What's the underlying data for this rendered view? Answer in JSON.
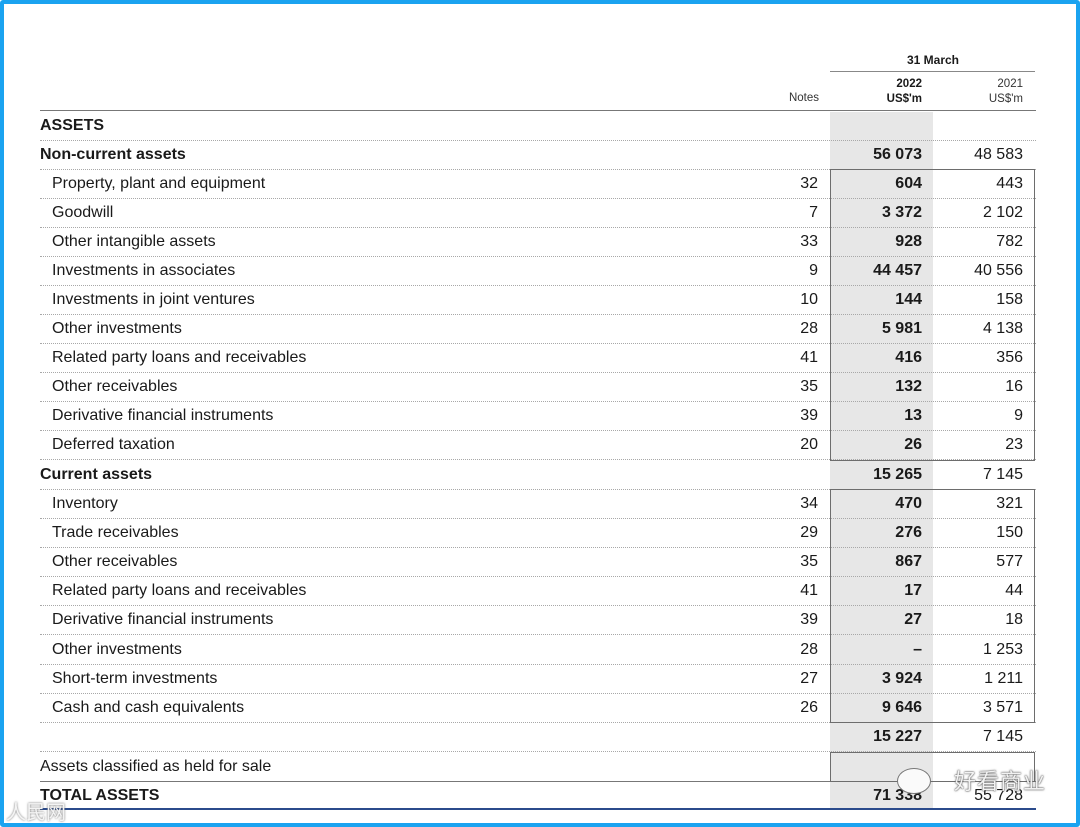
{
  "header": {
    "period": "31 March",
    "year_current": "2022",
    "unit_current": "US$'m",
    "year_prior": "2021",
    "unit_prior": "US$'m",
    "notes_label": "Notes"
  },
  "rows": [
    {
      "label": "ASSETS",
      "note": "",
      "v2022": "",
      "v2021": ""
    },
    {
      "label": "Non-current assets",
      "note": "",
      "v2022": "56 073",
      "v2021": "48 583"
    },
    {
      "label": "Property, plant and equipment",
      "note": "32",
      "v2022": "604",
      "v2021": "443"
    },
    {
      "label": "Goodwill",
      "note": "7",
      "v2022": "3 372",
      "v2021": "2 102"
    },
    {
      "label": "Other intangible assets",
      "note": "33",
      "v2022": "928",
      "v2021": "782"
    },
    {
      "label": "Investments in associates",
      "note": "9",
      "v2022": "44 457",
      "v2021": "40 556"
    },
    {
      "label": "Investments in joint ventures",
      "note": "10",
      "v2022": "144",
      "v2021": "158"
    },
    {
      "label": "Other investments",
      "note": "28",
      "v2022": "5 981",
      "v2021": "4 138"
    },
    {
      "label": "Related party loans and receivables",
      "note": "41",
      "v2022": "416",
      "v2021": "356"
    },
    {
      "label": "Other receivables",
      "note": "35",
      "v2022": "132",
      "v2021": "16"
    },
    {
      "label": "Derivative financial instruments",
      "note": "39",
      "v2022": "13",
      "v2021": "9"
    },
    {
      "label": "Deferred taxation",
      "note": "20",
      "v2022": "26",
      "v2021": "23"
    },
    {
      "label": "Current assets",
      "note": "",
      "v2022": "15 265",
      "v2021": "7 145"
    },
    {
      "label": "Inventory",
      "note": "34",
      "v2022": "470",
      "v2021": "321"
    },
    {
      "label": "Trade receivables",
      "note": "29",
      "v2022": "276",
      "v2021": "150"
    },
    {
      "label": "Other receivables",
      "note": "35",
      "v2022": "867",
      "v2021": "577"
    },
    {
      "label": "Related party loans and receivables",
      "note": "41",
      "v2022": "17",
      "v2021": "44"
    },
    {
      "label": "Derivative financial instruments",
      "note": "39",
      "v2022": "27",
      "v2021": "18"
    },
    {
      "label": "Other investments",
      "note": "28",
      "v2022": "–",
      "v2021": "1 253"
    },
    {
      "label": "Short-term investments",
      "note": "27",
      "v2022": "3 924",
      "v2021": "1 211"
    },
    {
      "label": "Cash and cash equivalents",
      "note": "26",
      "v2022": "9 646",
      "v2021": "3 571"
    },
    {
      "label": "",
      "note": "",
      "v2022": "15 227",
      "v2021": "7 145"
    },
    {
      "label": "Assets classified as held for sale",
      "note": "",
      "v2022": "",
      "v2021": ""
    },
    {
      "label": "TOTAL ASSETS",
      "note": "",
      "v2022": "71 338",
      "v2021": "55 728"
    }
  ],
  "watermark": {
    "right": "好看商业",
    "left": "人民网"
  }
}
